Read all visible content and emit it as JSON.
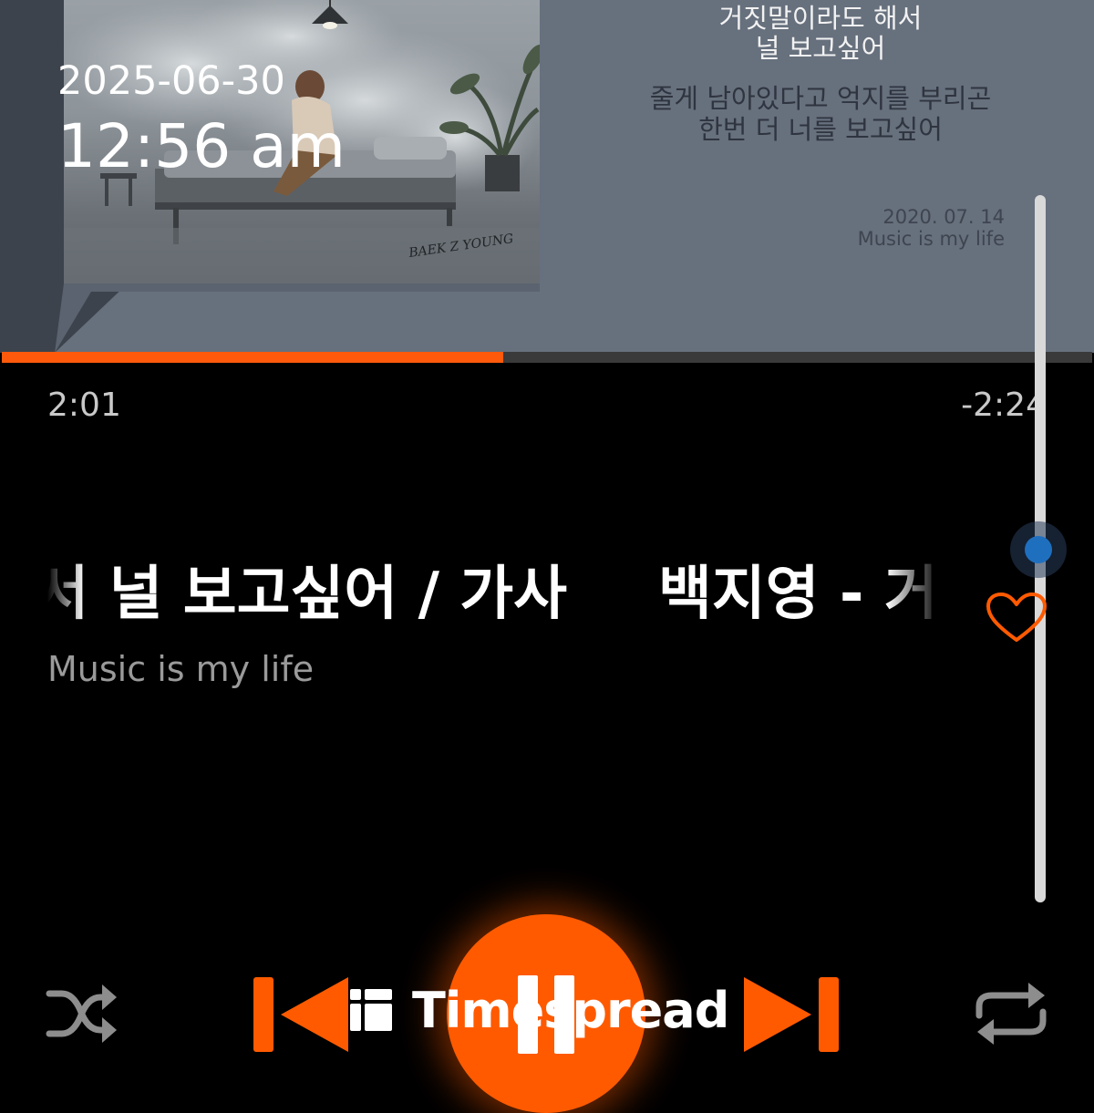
{
  "overlay": {
    "date": "2025-06-30",
    "time": "12:56 am"
  },
  "album_art": {
    "lyrics": [
      "거짓말이라도 해서",
      "널 보고싶어",
      "줄게 남아있다고 억지를 부리곤",
      "한번 더 너를 보고싶어"
    ],
    "release_date": "2020. 07. 14",
    "channel": "Music is my life",
    "signature": "BAEK Z YOUNG"
  },
  "progress": {
    "elapsed": "2:01",
    "remaining": "-2:24",
    "fraction": 0.46
  },
  "track": {
    "title_scroll_a": "백지영 - 거짓말이라도 해서 널 보고싶어 / 가사",
    "title_scroll_b": "백지영 - 거",
    "artist": "Music is my life"
  },
  "volume": {
    "level": 0.5
  },
  "controls": {
    "shuffle": "shuffle-icon",
    "previous": "previous-icon",
    "play_pause": "pause-icon",
    "next": "next-icon",
    "repeat": "repeat-icon",
    "favorite": "heart-icon"
  },
  "watermark": {
    "text": "Timespread"
  },
  "colors": {
    "accent": "#ff5a00",
    "volume_knob": "#1f6fbf",
    "art_background": "#67707d"
  }
}
